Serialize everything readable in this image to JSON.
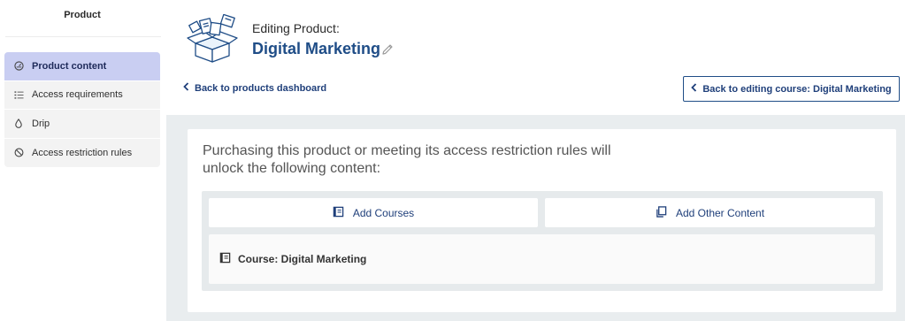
{
  "sidebar": {
    "title": "Product",
    "items": [
      {
        "label": "Product content",
        "icon": "gauge-icon",
        "active": true
      },
      {
        "label": "Access requirements",
        "icon": "list-icon",
        "active": false
      },
      {
        "label": "Drip",
        "icon": "drop-icon",
        "active": false
      },
      {
        "label": "Access restriction rules",
        "icon": "ban-icon",
        "active": false
      }
    ]
  },
  "header": {
    "subtitle": "Editing Product:",
    "title": "Digital Marketing",
    "illustration_icon": "open-box-illustration",
    "edit_icon": "pencil-icon"
  },
  "nav": {
    "back_dashboard": "Back to products dashboard",
    "back_course": "Back to editing course: Digital Marketing"
  },
  "main": {
    "description": "Purchasing this product or meeting its access restriction rules will unlock the following content:",
    "add_courses": "Add Courses",
    "add_other": "Add Other Content",
    "course_item": "Course: Digital Marketing"
  },
  "colors": {
    "accent": "#1f4d87",
    "active_bg": "#c9cef2",
    "panel_bg": "#e9edef"
  }
}
